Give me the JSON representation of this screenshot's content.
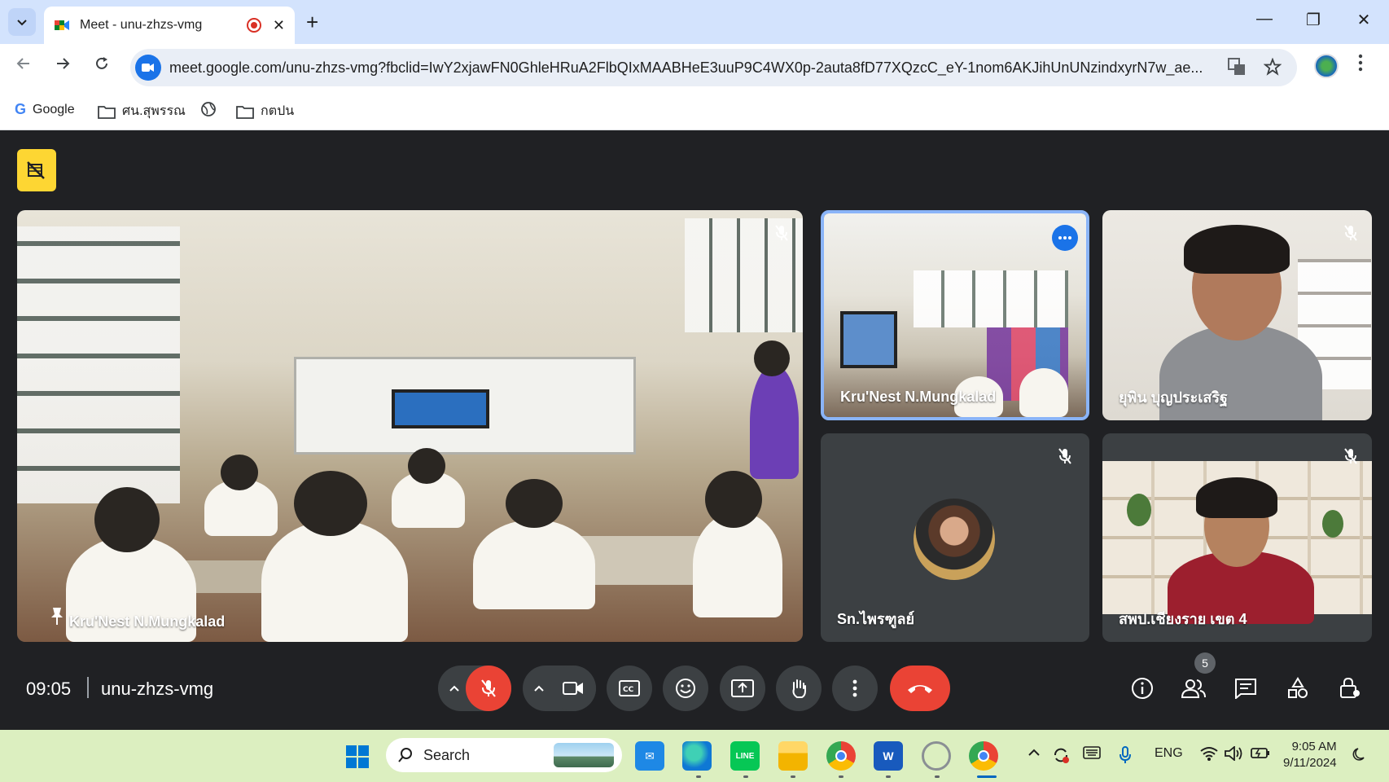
{
  "browser": {
    "tab_title": "Meet - unu-zhzs-vmg",
    "new_tab_symbol": "+",
    "tab_close_symbol": "✕",
    "url": "meet.google.com/unu-zhzs-vmg?fbclid=IwY2xjawFN0GhleHRuA2FlbQIxMAABHeE3uuP9C4WX0p-2auta8fD77XQzcC_eY-1nom6AKJihUnUNzindxyrN7w_ae...",
    "window_controls": [
      "—",
      "❐",
      "✕"
    ],
    "bookmarks": [
      {
        "label": "Google",
        "icon": "google-icon"
      },
      {
        "label": "ศน.สุพรรณ",
        "icon": "folder-icon"
      },
      {
        "label": "",
        "icon": "globe-icon"
      },
      {
        "label": "กตปน",
        "icon": "folder-icon"
      }
    ]
  },
  "meet": {
    "tiles": [
      {
        "name": "Kru'Nest N.Mungkalad",
        "muted": true,
        "pinned": true
      },
      {
        "name": "Kru'Nest N.Mungkalad",
        "muted": false,
        "active": true
      },
      {
        "name": "ยุพิน บุญประเสริฐ",
        "muted": true
      },
      {
        "name": "Sn.ไพรฑูลย์",
        "muted": true
      },
      {
        "name": "สพป.เชียงราย เขต 4",
        "muted": true
      }
    ],
    "clock": "09:05",
    "meeting_code": "unu-zhzs-vmg",
    "participant_count": "5",
    "accent_red": "#ea4335",
    "active_border": "#8ab4f8"
  },
  "taskbar": {
    "search_label": "Search",
    "lang": "ENG",
    "time": "9:05 AM",
    "date": "9/11/2024",
    "apps": [
      "mail-icon",
      "edge-icon",
      "line-icon",
      "file-explorer-icon",
      "chrome-icon",
      "word-icon",
      "webcam-icon",
      "chrome-active-icon"
    ]
  }
}
